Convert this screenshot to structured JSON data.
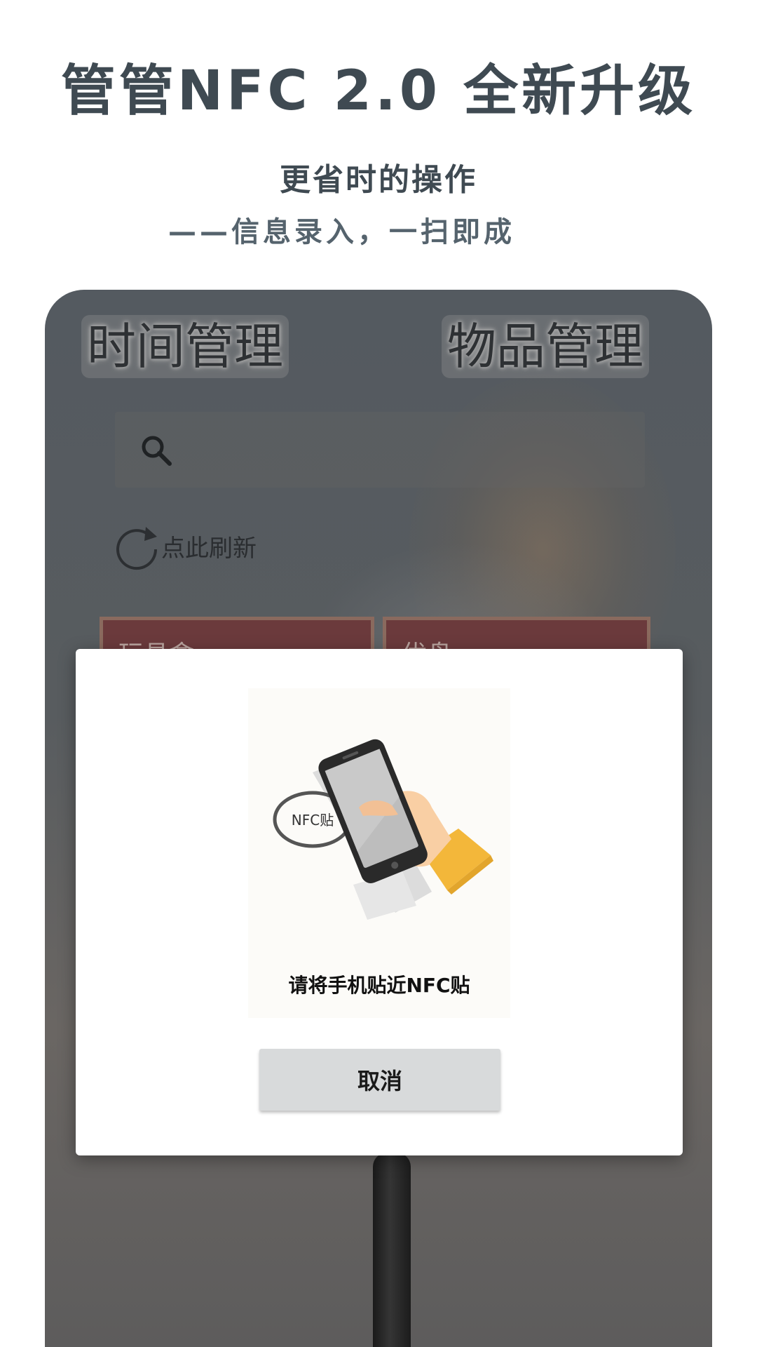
{
  "header": {
    "title": "管管NFC 2.0 全新升级",
    "subtitle": "更省时的操作",
    "tagline": "——信息录入，一扫即成"
  },
  "app": {
    "tabs": [
      {
        "label": "时间管理"
      },
      {
        "label": "物品管理"
      }
    ],
    "search": {
      "icon": "search-icon",
      "value": ""
    },
    "refresh": {
      "icon": "refresh-icon",
      "label": "点此刷新"
    },
    "cards": [
      {
        "label": "玩具盒"
      },
      {
        "label": "优盘"
      }
    ]
  },
  "dialog": {
    "illustration_tag": "NFC贴",
    "hint": "请将手机贴近NFC贴",
    "cancel_label": "取消"
  },
  "colors": {
    "headline": "#3f4a52",
    "card_bg": "#6b3a3c",
    "button_bg": "#d8dadb",
    "sleeve": "#f3b73a",
    "hand": "#f9cfa4"
  }
}
